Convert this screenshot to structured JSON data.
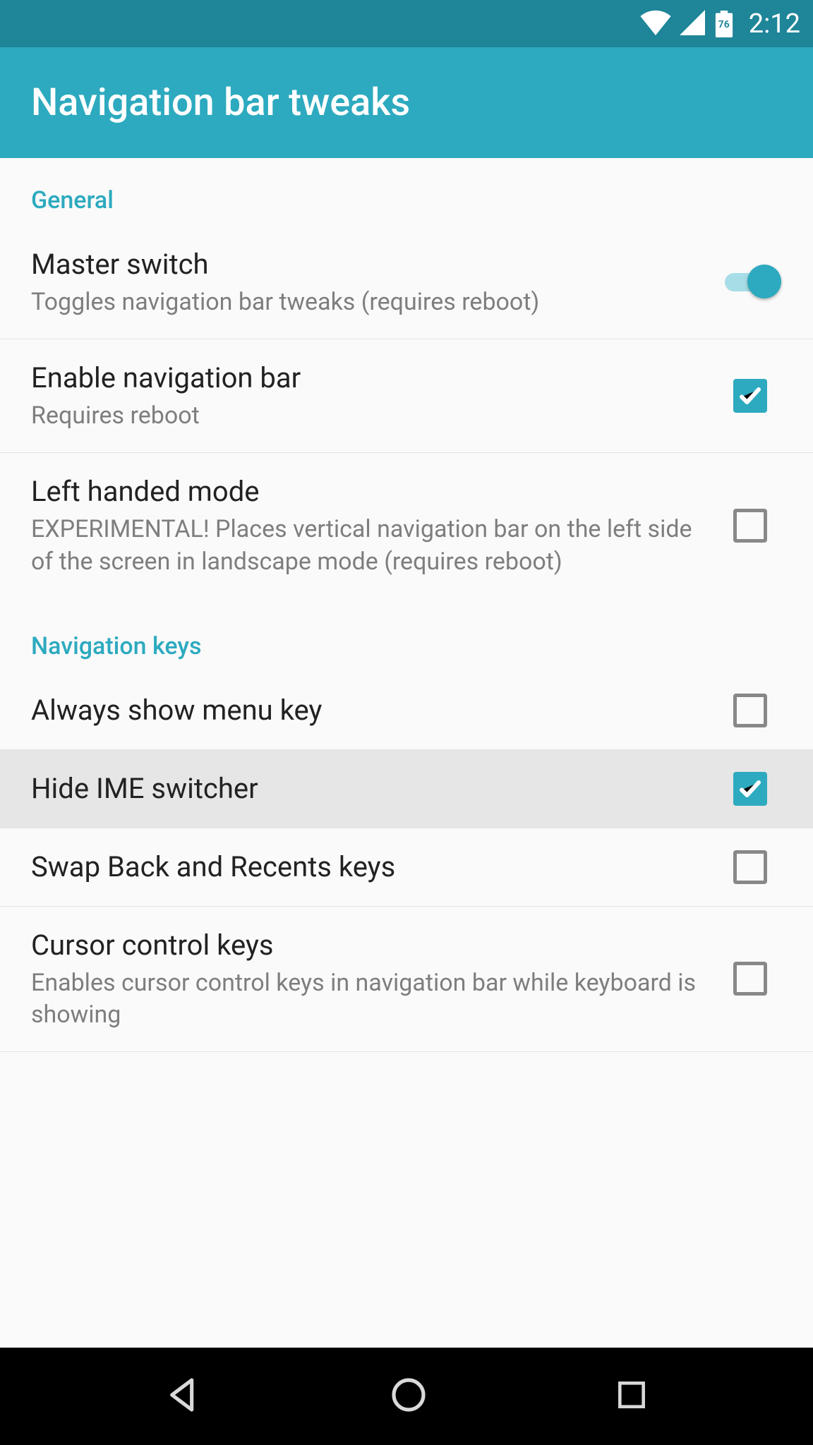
{
  "status_bar": {
    "battery_pct": "76",
    "time": "2:12"
  },
  "app_bar": {
    "title": "Navigation bar tweaks"
  },
  "sections": [
    {
      "header": "General",
      "rows": [
        {
          "title": "Master switch",
          "sub": "Toggles navigation bar tweaks (requires reboot)",
          "control": "switch",
          "value": true
        },
        {
          "title": "Enable navigation bar",
          "sub": "Requires reboot",
          "control": "checkbox",
          "value": true
        },
        {
          "title": "Left handed mode",
          "sub": "EXPERIMENTAL! Places vertical navigation bar on the left side of the screen in landscape mode (requires reboot)",
          "control": "checkbox",
          "value": false
        }
      ]
    },
    {
      "header": "Navigation keys",
      "rows": [
        {
          "title": "Always show menu key",
          "control": "checkbox",
          "value": false
        },
        {
          "title": "Hide IME switcher",
          "control": "checkbox",
          "value": true,
          "highlighted": true
        },
        {
          "title": "Swap Back and Recents keys",
          "control": "checkbox",
          "value": false
        },
        {
          "title": "Cursor control keys",
          "sub": "Enables cursor control keys in navigation bar while keyboard is showing",
          "control": "checkbox",
          "value": false
        }
      ]
    }
  ],
  "partial_row_title": ""
}
